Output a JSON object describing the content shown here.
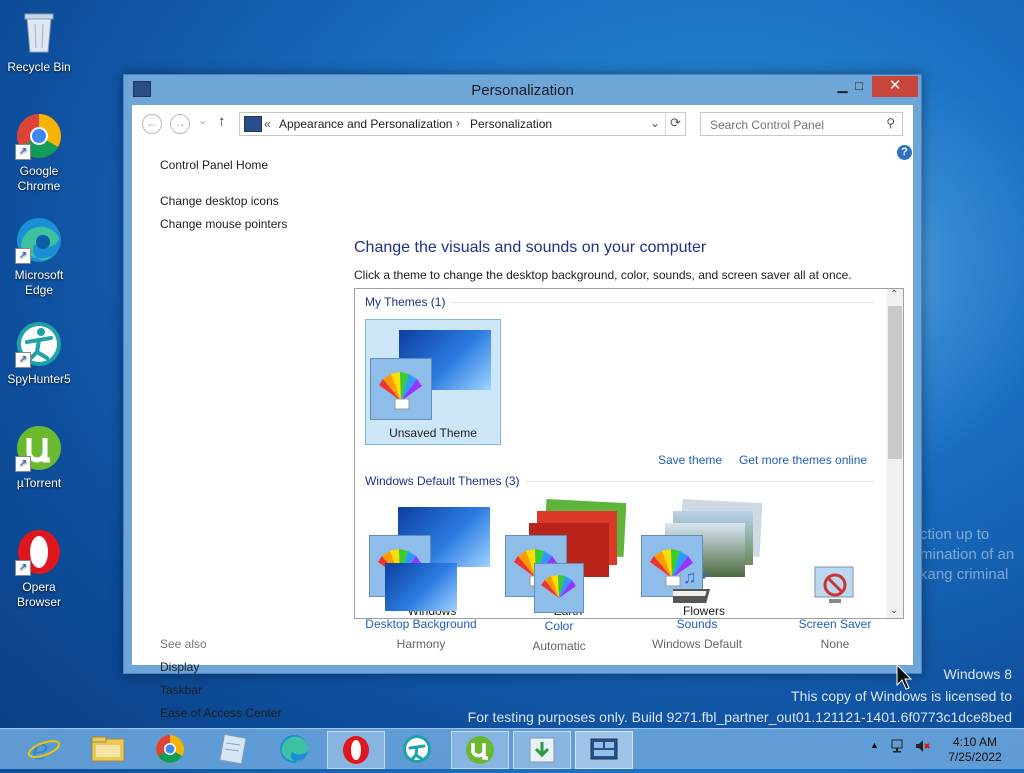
{
  "desktop": {
    "icons": [
      {
        "label": "Recycle Bin"
      },
      {
        "label": "Google Chrome"
      },
      {
        "label": "Microsoft Edge"
      },
      {
        "label": "SpyHunter5"
      },
      {
        "label": "µTorrent"
      },
      {
        "label": "Opera Browser"
      }
    ],
    "watermark_line1": "Windows 8",
    "watermark_line2": "This copy of Windows is licensed to",
    "watermark_line3": "For testing purposes only. Build 9271.fbl_partner_out01.121121-1401.6f0773c1dce8bed",
    "background_text": "ction up to\nmination of an\nkang criminal"
  },
  "window": {
    "title": "Personalization",
    "nav": {
      "back": "←",
      "forward": "→",
      "recent": "⌄",
      "up": "↑"
    },
    "address": {
      "prefix": "«",
      "crumb1": "Appearance and Personalization",
      "separator": "›",
      "crumb2": "Personalization"
    },
    "search_placeholder": "Search Control Panel",
    "left_links": {
      "home": "Control Panel Home",
      "desktop_icons": "Change desktop icons",
      "mouse_pointers": "Change mouse pointers"
    },
    "see_also": {
      "label": "See also",
      "display": "Display",
      "taskbar": "Taskbar",
      "ease": "Ease of Access Center"
    },
    "heading": "Change the visuals and sounds on your computer",
    "subhead": "Click a theme to change the desktop background, color, sounds, and screen saver all at once.",
    "my_themes": {
      "label": "My Themes (1)",
      "items": [
        {
          "name": "Unsaved Theme"
        }
      ],
      "save_link": "Save theme",
      "more_link": "Get more themes online"
    },
    "default_themes": {
      "label": "Windows Default Themes (3)",
      "items": [
        {
          "name": "Windows"
        },
        {
          "name": "Earth"
        },
        {
          "name": "Flowers"
        }
      ]
    },
    "bottom": {
      "background": {
        "label": "Desktop Background",
        "value": "Harmony"
      },
      "color": {
        "label": "Color",
        "value": "Automatic"
      },
      "sounds": {
        "label": "Sounds",
        "value": "Windows Default"
      },
      "screensaver": {
        "label": "Screen Saver",
        "value": "None"
      }
    }
  },
  "taskbar": {
    "time": "4:10 AM",
    "date": "7/25/2022"
  },
  "colors": {
    "link": "#1e5fb4",
    "heading": "#1e3287",
    "close_button": "#c7453a",
    "selection": "#cde6f7"
  }
}
